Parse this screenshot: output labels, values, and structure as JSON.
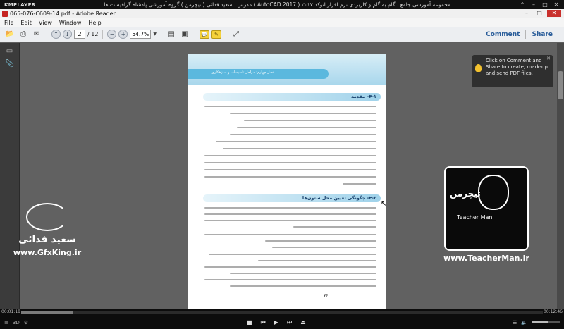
{
  "kmplayer": {
    "logo": "KMPLAYER",
    "title": "مجموعه آموزشی جامع ، گام به گام و کاربردی نرم افزار  اتوکد ۲۰۱۷ ( AutoCAD 2017 )  مدرس : سعید فدائی ( تیچرمن ) گروه آموزشی پادشاه گرافیست ها",
    "time_elapsed": "00:01:18",
    "time_total": "00:12:46",
    "progress": 0.1,
    "volume": 0.6
  },
  "reader": {
    "window_title": "065-076-C609-14.pdf - Adobe Reader",
    "menu": [
      "File",
      "Edit",
      "View",
      "Window",
      "Help"
    ],
    "page_current": "2",
    "page_total": "/ 12",
    "zoom": "54.7%",
    "comment_label": "Comment",
    "share_label": "Share",
    "tooltip": "Click on Comment and Share to create, mark-up and send PDF files.",
    "page": {
      "header_band": "فصل چهارم: مراحل تاسیسات و سازهکاری",
      "section1": "۴-۱- مقدمه",
      "section2": "۴-۲- چگونگی تعیین محل ستون‌ها",
      "page_number": "۷۶"
    }
  },
  "watermark": {
    "left_name": "سعید فدائی",
    "left_url": "www.GfxKing.ir",
    "right_brand": "تیچرمن",
    "right_en": "Teacher Man",
    "right_url": "www.TeacherMan.ir"
  },
  "colors": {
    "accent_blue": "#5bb8de",
    "link_blue": "#2a5d9a",
    "close_red": "#c9302c"
  }
}
